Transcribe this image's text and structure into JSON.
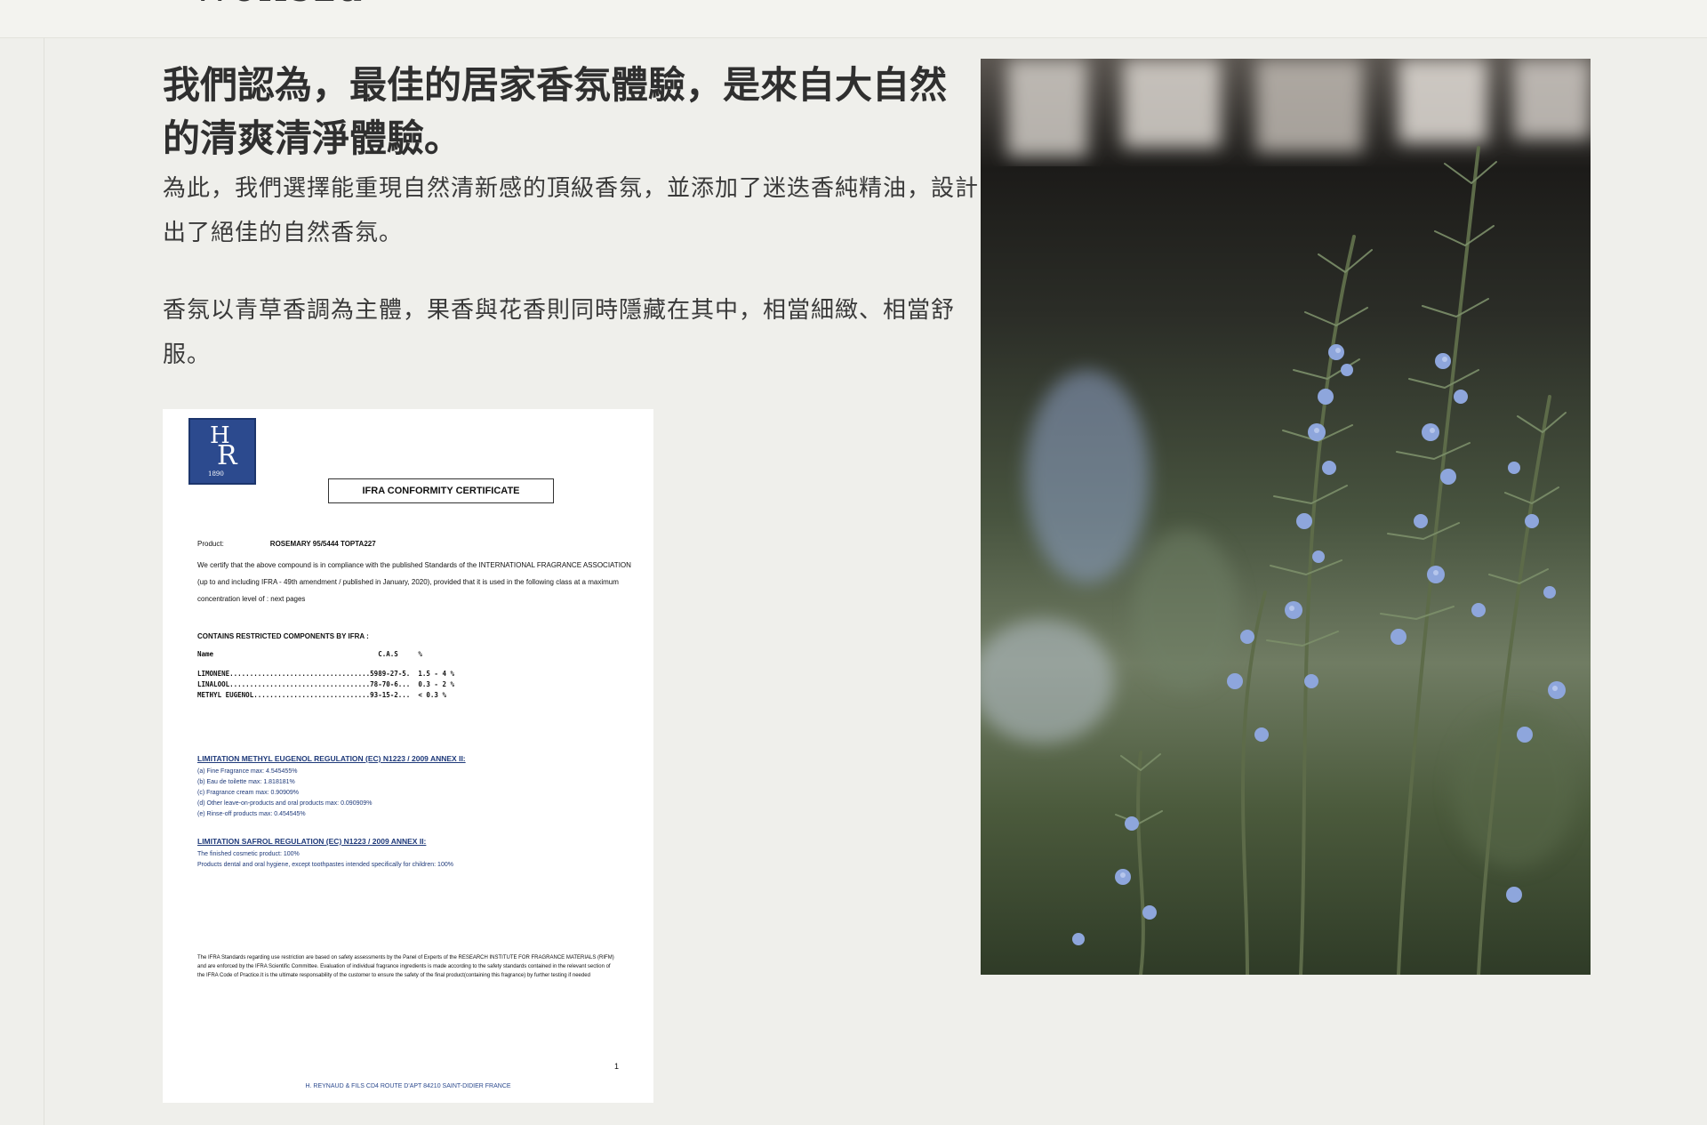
{
  "header": {
    "logo_text": "Wellsza"
  },
  "content": {
    "heading": "我們認為，最佳的居家香氛體驗，是來自大自然的清爽清淨體驗。",
    "paragraph1": "為此，我們選擇能重現自然清新感的頂級香氛，並添加了迷迭香純精油，設計出了絕佳的自然香氛。",
    "paragraph2": "香氛以青草香調為主體，果香與花香則同時隱藏在其中，相當細緻、相當舒服。"
  },
  "certificate": {
    "logo_h": "H",
    "logo_r": "R",
    "logo_year": "1890",
    "title": "IFRA CONFORMITY CERTIFICATE",
    "product_label": "Product:",
    "product_value": "ROSEMARY 95/5444 TOPTA227",
    "certify_text": "We certify that the above compound is in compliance with the published Standards of the INTERNATIONAL FRAGRANCE ASSOCIATION (up to and including IFRA - 49th amendment / published in January, 2020), provided that it is used in the following class at a maximum concentration level of : next pages",
    "restricted_title": "CONTAINS RESTRICTED COMPONENTS BY IFRA :",
    "table_header": "Name                                         C.A.S     %",
    "table_rows": "LIMONENE...................................5989-27-5.  1.5 - 4 %\nLINALOOL...................................78-70-6...  0.3 - 2 %\nMETHYL EUGENOL.............................93-15-2...  < 0.3 %",
    "section1_title": "LIMITATION METHYL EUGENOL REGULATION (EC) N1223 / 2009 ANNEX II:",
    "section1_items": "(a) Fine Fragrance max: 4.545455%\n(b) Eau de toilette max: 1.818181%\n(c) Fragrance cream max: 0.90909%\n(d) Other leave-on-products and oral products max: 0.090909%\n(e) Rinse-off products max: 0.454545%",
    "section2_title": "LIMITATION SAFROL REGULATION (EC) N1223 / 2009 ANNEX II:",
    "section2_items": "The finished cosmetic product: 100%\nProducts dental and oral hygiene, except toothpastes intended specifically for children: 100%",
    "footer_text": "The IFRA Standards regarding use restriction are based on safety assessments by the Panel of Experts of the RESEARCH INSTITUTE FOR FRAGRANCE MATERIALS (RIFM) and are enforced by the IFRA Scientific Committee. Evaluation of individual fragrance ingredients is made according to the safety standards contained in the relevant section of the IFRA Code of Practice.It is the ultimate responsability of the customer to ensure the safety of the final product(containing this fragrance) by further testing if needed",
    "page_number": "1",
    "address": "H. REYNAUD & FILS CD4 ROUTE D'APT 84210 SAINT-DIDIER FRANCE"
  },
  "colors": {
    "background": "#efefeb",
    "cert_blue": "#2c4a8e",
    "flower_blue": "#8ea6dc"
  }
}
